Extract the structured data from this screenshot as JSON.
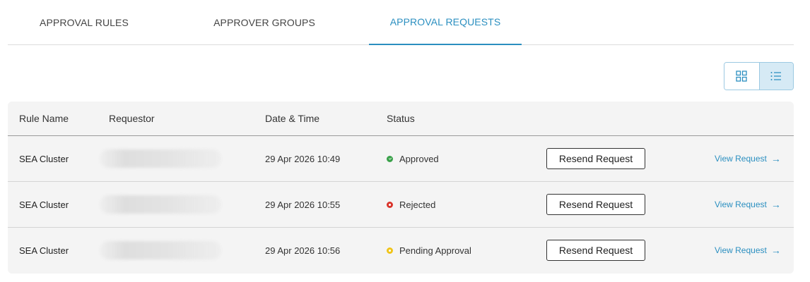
{
  "tabs": [
    {
      "label": "APPROVAL RULES"
    },
    {
      "label": "APPROVER GROUPS"
    },
    {
      "label": "APPROVAL REQUESTS"
    }
  ],
  "active_tab": "APPROVAL REQUESTS",
  "view_toggle": {
    "options": [
      "grid-view-icon",
      "list-view-icon"
    ],
    "active": "list-view-icon"
  },
  "table": {
    "headers": {
      "rule_name": "Rule Name",
      "requestor": "Requestor",
      "date_time": "Date & Time",
      "status": "Status"
    },
    "rows": [
      {
        "rule_name": "SEA Cluster",
        "date_time": "29 Apr 2026 10:49",
        "status": "Approved",
        "status_color": "#3aa14a",
        "resend": "Resend Request",
        "view": "View Request"
      },
      {
        "rule_name": "SEA Cluster",
        "date_time": "29 Apr 2026 10:55",
        "status": "Rejected",
        "status_color": "#d9342b",
        "resend": "Resend Request",
        "view": "View Request"
      },
      {
        "rule_name": "SEA Cluster",
        "date_time": "29 Apr 2026 10:56",
        "status": "Pending Approval",
        "status_color": "#f0c419",
        "resend": "Resend Request",
        "view": "View Request"
      }
    ]
  },
  "colors": {
    "accent": "#2b8fc0"
  }
}
